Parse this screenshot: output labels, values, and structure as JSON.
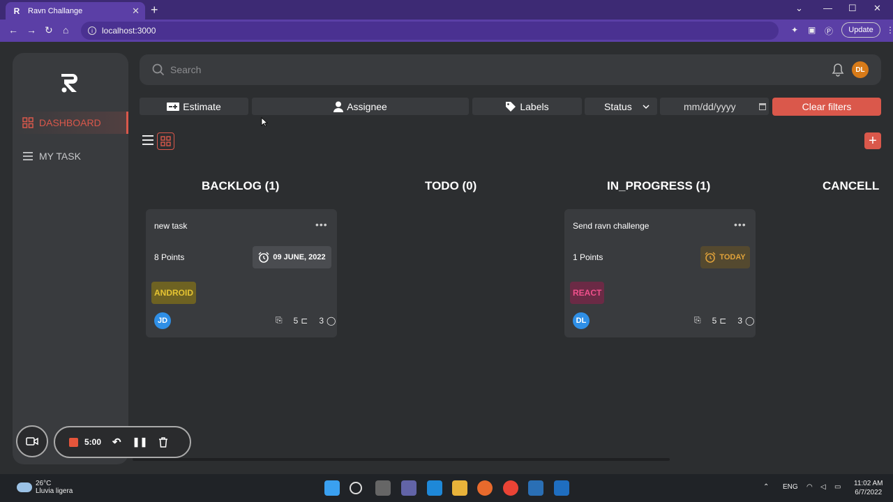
{
  "browser": {
    "tab_title": "Ravn Challange",
    "url": "localhost:3000",
    "update_label": "Update"
  },
  "sidebar": {
    "brand": "R",
    "items": [
      {
        "label": "DASHBOARD",
        "icon": "grid-icon",
        "active": true
      },
      {
        "label": "MY TASK",
        "icon": "menu-icon",
        "active": false
      }
    ]
  },
  "header": {
    "search_placeholder": "Search",
    "user_initials": "DL"
  },
  "filters": {
    "estimate": "Estimate",
    "assignee": "Assignee",
    "labels": "Labels",
    "status": "Status",
    "date_placeholder": "mm/dd/yyyy",
    "clear": "Clear filters"
  },
  "columns": [
    {
      "title": "BACKLOG (1)"
    },
    {
      "title": "TODO (0)"
    },
    {
      "title": "IN_PROGRESS (1)"
    },
    {
      "title": "CANCELL"
    }
  ],
  "cards": [
    {
      "name": "new task",
      "points": "8 Points",
      "due": "09 JUNE, 2022",
      "tag": "ANDROID",
      "assignee": "JD",
      "subtasks": "5",
      "comments": "3"
    },
    {
      "name": "Send ravn challenge",
      "points": "1 Points",
      "due": "TODAY",
      "tag": "REACT",
      "assignee": "DL",
      "subtasks": "5",
      "comments": "3"
    }
  ],
  "recorder": {
    "time": "5:00"
  },
  "taskbar": {
    "temp": "26°C",
    "weather": "Lluvia ligera",
    "lang": "ENG",
    "time": "11:02 AM",
    "date": "6/7/2022"
  },
  "colors": {
    "accent": "#da584b",
    "surface": "#393b3e",
    "background": "#2c2e30",
    "android_tag": "#b89a1f",
    "react_tag": "#c0356a",
    "today": "#e0a23a"
  }
}
